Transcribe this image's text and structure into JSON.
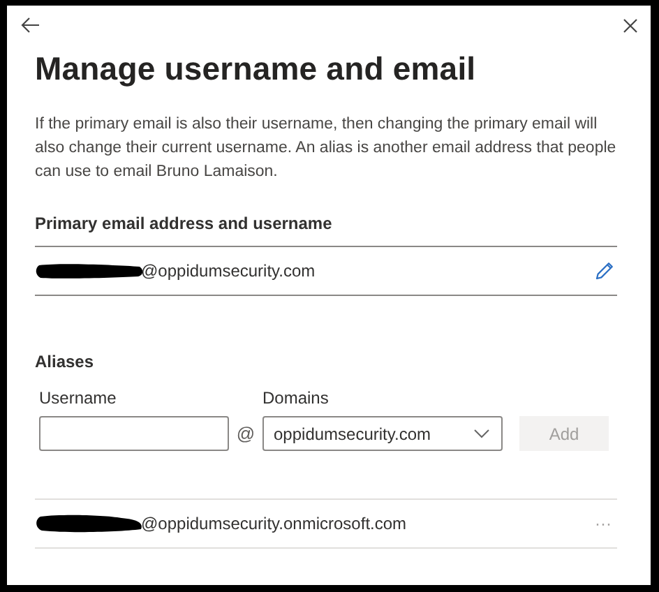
{
  "panel": {
    "title": "Manage username and email",
    "description": "If the primary email is also their username, then changing the primary email will also change their current username. An alias is another email address that people can use to email Bruno Lamaison."
  },
  "primary": {
    "heading": "Primary email address and username",
    "email": "@oppidumsecurity.com",
    "redacted": true
  },
  "aliases": {
    "heading": "Aliases",
    "username_label": "Username",
    "at_sign": "@",
    "domains_label": "Domains",
    "domain_value": "oppidumsecurity.com",
    "add_button": {
      "label": "Add",
      "disabled": true
    },
    "items": [
      {
        "email": "@oppidumsecurity.onmicrosoft.com",
        "redacted": true,
        "more": "···"
      }
    ]
  }
}
